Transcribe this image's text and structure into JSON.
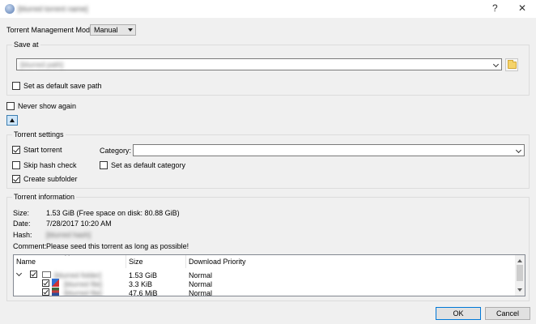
{
  "window": {
    "title": "[blurred torrent name]",
    "help_glyph": "?",
    "close_glyph": "✕"
  },
  "management": {
    "label": "Torrent Management Mode:",
    "mode": "Manual"
  },
  "save_at": {
    "group_label": "Save at",
    "path": "[blurred path]",
    "set_default_label": "Set as default save path",
    "set_default_checked": false
  },
  "never_show": {
    "label": "Never show again",
    "checked": false
  },
  "torrent_settings": {
    "group_label": "Torrent settings",
    "start_torrent": {
      "label": "Start torrent",
      "checked": true
    },
    "skip_hash": {
      "label": "Skip hash check",
      "checked": false
    },
    "create_subfolder": {
      "label": "Create subfolder",
      "checked": true
    },
    "category_label": "Category:",
    "category_value": "",
    "set_default_category": {
      "label": "Set as default category",
      "checked": false
    }
  },
  "torrent_info": {
    "group_label": "Torrent information",
    "size_label": "Size:",
    "size_value": "1.53 GiB (Free space on disk: 80.88 GiB)",
    "date_label": "Date:",
    "date_value": "7/28/2017 10:20 AM",
    "hash_label": "Hash:",
    "hash_value": "[blurred hash]",
    "comment_label": "Comment:",
    "comment_value": "Please seed this torrent as long as possible!"
  },
  "file_tree": {
    "columns": [
      "Name",
      "Size",
      "Download Priority"
    ],
    "rows": [
      {
        "name": "[blurred folder]",
        "size": "1.53 GiB",
        "priority": "Normal",
        "checked": true
      },
      {
        "name": "[blurred file]",
        "size": "3.3 KiB",
        "priority": "Normal",
        "checked": true
      },
      {
        "name": "[blurred file]",
        "size": "47.6 MiB",
        "priority": "Normal",
        "checked": true
      }
    ]
  },
  "buttons": {
    "ok": "OK",
    "cancel": "Cancel"
  },
  "colors": {
    "accent": "#0078d7",
    "background": "#f0f0f0",
    "toggle_bg": "#cfe6f9"
  }
}
